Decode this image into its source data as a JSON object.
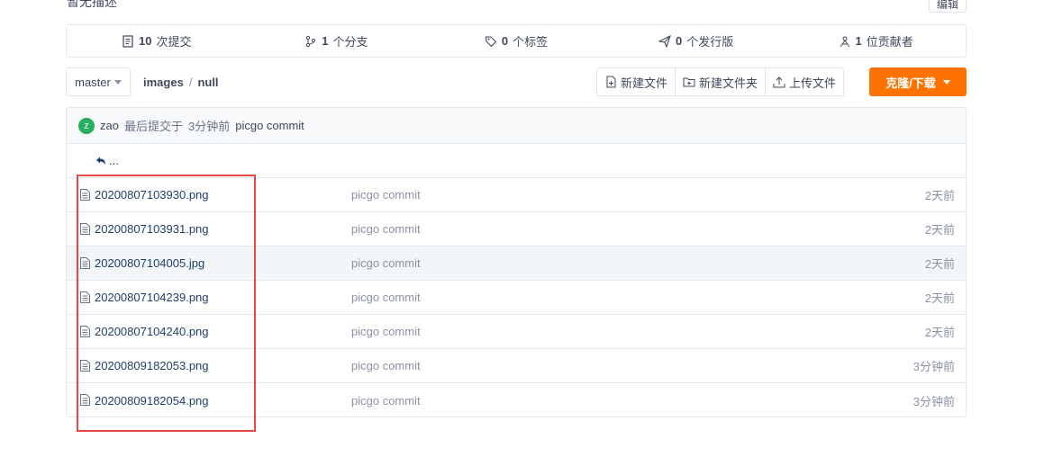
{
  "header": {
    "description": "暂无描述",
    "edit_label": "编辑"
  },
  "stats": [
    {
      "icon": "commits-icon",
      "count": "10",
      "label": "次提交"
    },
    {
      "icon": "branch-icon",
      "count": "1",
      "label": "个分支"
    },
    {
      "icon": "tag-icon",
      "count": "0",
      "label": "个标签"
    },
    {
      "icon": "release-icon",
      "count": "0",
      "label": "个发行版"
    },
    {
      "icon": "contributors-icon",
      "count": "1",
      "label": "位贡献者"
    }
  ],
  "toolbar": {
    "branch": "master",
    "breadcrumb": [
      "images",
      "/",
      "null"
    ],
    "new_file": "新建文件",
    "new_folder": "新建文件夹",
    "upload": "上传文件",
    "clone": "克隆/下载"
  },
  "latest_commit": {
    "avatar_letter": "z",
    "author": "zao",
    "prefix": "最后提交于",
    "time": "3分钟前",
    "message": "picgo commit"
  },
  "back_text": "...",
  "files": [
    {
      "name": "20200807103930.png",
      "commit": "picgo commit",
      "time": "2天前"
    },
    {
      "name": "20200807103931.png",
      "commit": "picgo commit",
      "time": "2天前"
    },
    {
      "name": "20200807104005.jpg",
      "commit": "picgo commit",
      "time": "2天前"
    },
    {
      "name": "20200807104239.png",
      "commit": "picgo commit",
      "time": "2天前"
    },
    {
      "name": "20200807104240.png",
      "commit": "picgo commit",
      "time": "2天前"
    },
    {
      "name": "20200809182053.png",
      "commit": "picgo commit",
      "time": "3分钟前"
    },
    {
      "name": "20200809182054.png",
      "commit": "picgo commit",
      "time": "3分钟前"
    }
  ],
  "colors": {
    "accent": "#fe7300",
    "link": "#1f3f6b",
    "highlight": "#ea4848"
  }
}
